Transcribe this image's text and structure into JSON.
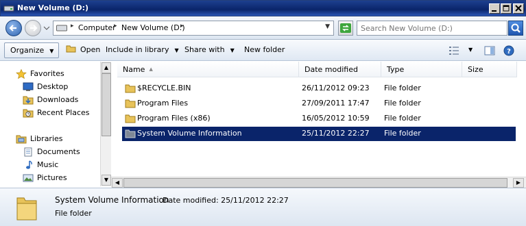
{
  "window": {
    "title": "New Volume (D:)"
  },
  "address": {
    "crumbs": [
      "Computer",
      "New Volume (D:)"
    ],
    "search_placeholder": "Search New Volume (D:)"
  },
  "toolbar": {
    "organize": "Organize",
    "open": "Open",
    "include_in_library": "Include in library",
    "share_with": "Share with",
    "new_folder": "New folder"
  },
  "nav": {
    "favorites_header": "Favorites",
    "favorites": [
      "Desktop",
      "Downloads",
      "Recent Places"
    ],
    "libraries_header": "Libraries",
    "libraries": [
      "Documents",
      "Music",
      "Pictures"
    ]
  },
  "columns": {
    "name": "Name",
    "date_modified": "Date modified",
    "type": "Type",
    "size": "Size"
  },
  "files": [
    {
      "name": "$RECYCLE.BIN",
      "date": "26/11/2012 09:23",
      "type": "File folder",
      "selected": false
    },
    {
      "name": "Program Files",
      "date": "27/09/2011 17:47",
      "type": "File folder",
      "selected": false
    },
    {
      "name": "Program Files (x86)",
      "date": "16/05/2012 10:59",
      "type": "File folder",
      "selected": false
    },
    {
      "name": "System Volume Information",
      "date": "25/11/2012 22:27",
      "type": "File folder",
      "selected": true
    }
  ],
  "details": {
    "name": "System Volume Information",
    "meta_label": "Date modified:",
    "meta_value": "25/11/2012 22:27",
    "type": "File folder"
  },
  "colors": {
    "selection": "#0a246a",
    "folder": "#e8c35a"
  }
}
